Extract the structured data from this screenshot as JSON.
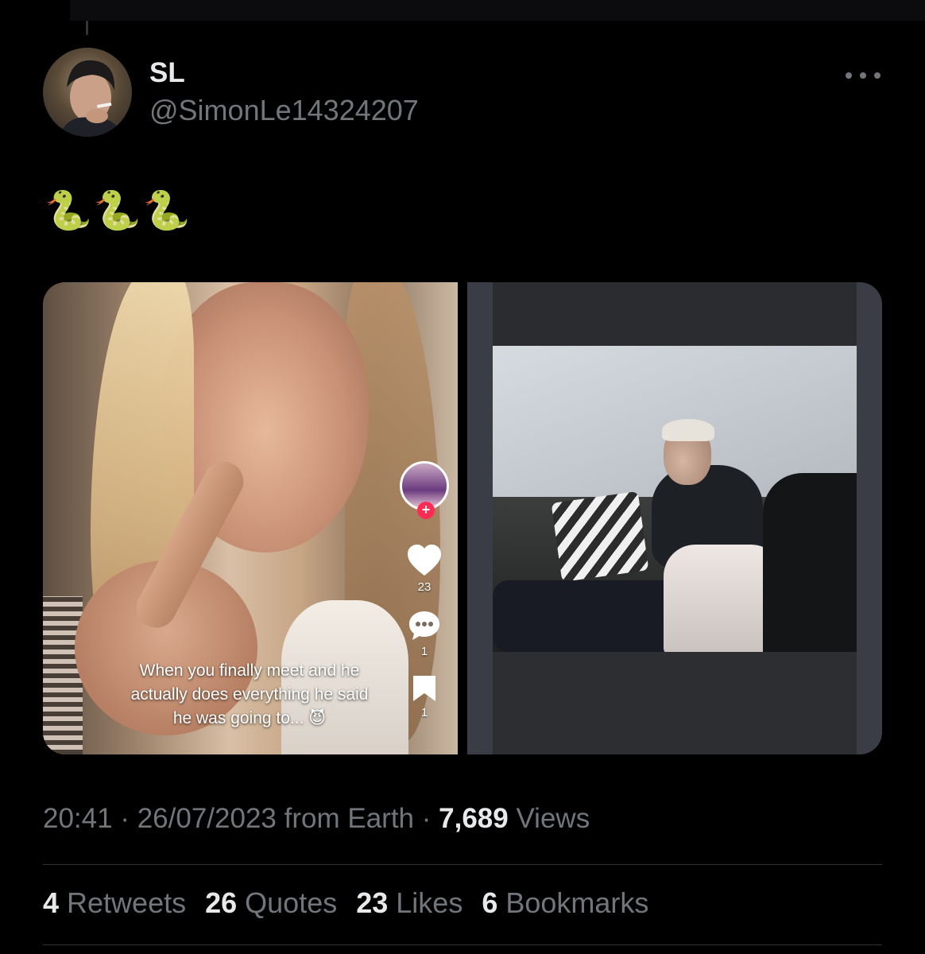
{
  "tweet": {
    "author": {
      "display_name": "SL",
      "handle": "@SimonLe14324207",
      "avatar_icon": "user-avatar"
    },
    "text": "🐍🐍🐍",
    "media": {
      "left": {
        "caption": "When you finally meet and he actually does everything he said he was going to... 😈",
        "likes": "23",
        "comments": "1",
        "bookmarks": "1"
      },
      "right": {}
    },
    "meta": {
      "time": "20:41",
      "date": "26/07/2023",
      "source": "from Earth",
      "views_count": "7,689",
      "views_label": "Views"
    },
    "stats": [
      {
        "count": "4",
        "label": "Retweets"
      },
      {
        "count": "26",
        "label": "Quotes"
      },
      {
        "count": "23",
        "label": "Likes"
      },
      {
        "count": "6",
        "label": "Bookmarks"
      }
    ],
    "colors": {
      "background": "#000000",
      "primary_text": "#e7e9ea",
      "secondary_text": "#71767b",
      "divider": "#2f3336",
      "tiktok_red": "#fe2c55"
    }
  }
}
